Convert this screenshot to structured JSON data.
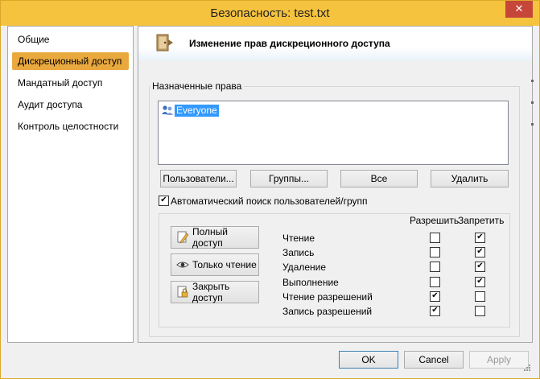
{
  "window": {
    "title": "Безопасность: test.txt",
    "close_glyph": "✕",
    "accent_color": "#f5c33d"
  },
  "nav": {
    "items": [
      {
        "label": "Общие",
        "active": false
      },
      {
        "label": "Дискреционный доступ",
        "active": true
      },
      {
        "label": "Мандатный доступ",
        "active": false
      },
      {
        "label": "Аудит доступа",
        "active": false
      },
      {
        "label": "Контроль целостности",
        "active": false
      }
    ]
  },
  "panel": {
    "title": "Изменение прав дискреционного доступа",
    "assigned_rights_label": "Назначенные права",
    "principals": [
      {
        "name": "Everyone",
        "selected": true,
        "icon": "users-group-icon"
      }
    ],
    "buttons": {
      "users": "Пользователи...",
      "groups": "Группы...",
      "all": "Все",
      "delete": "Удалить"
    },
    "auto_search": {
      "label": "Автоматический поиск пользователей/групп",
      "checked": true
    },
    "columns": {
      "allow": "Разрешить",
      "deny": "Запретить"
    },
    "quick_buttons": {
      "full_access": "Полный доступ",
      "read_only": "Только чтение",
      "close_access": "Закрыть доступ"
    },
    "permissions": [
      {
        "label": "Чтение",
        "allow": false,
        "deny": true
      },
      {
        "label": "Запись",
        "allow": false,
        "deny": true
      },
      {
        "label": "Удаление",
        "allow": false,
        "deny": true
      },
      {
        "label": "Выполнение",
        "allow": false,
        "deny": true
      },
      {
        "label": "Чтение разрешений",
        "allow": true,
        "deny": false
      },
      {
        "label": "Запись разрешений",
        "allow": true,
        "deny": false
      }
    ]
  },
  "footer": {
    "ok": "OK",
    "cancel": "Cancel",
    "apply": "Apply"
  }
}
